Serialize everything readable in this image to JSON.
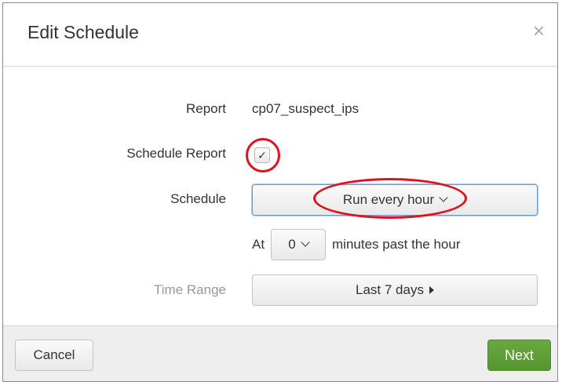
{
  "dialog": {
    "title": "Edit Schedule",
    "close_label": "×"
  },
  "form": {
    "report_label": "Report",
    "report_value": "cp07_suspect_ips",
    "schedule_report_label": "Schedule Report",
    "schedule_report_checked": true,
    "schedule_report_check_glyph": "✓",
    "schedule_label": "Schedule",
    "schedule_value": "Run every hour",
    "at_label": "At",
    "minute_value": "0",
    "minutes_suffix": "minutes past the hour",
    "time_range_label": "Time Range",
    "time_range_value": "Last 7 days"
  },
  "footer": {
    "cancel_label": "Cancel",
    "next_label": "Next"
  },
  "annotations": {
    "highlight_color": "#e0111c"
  },
  "colors": {
    "primary_button": "#5fa035",
    "focus_border": "#6e9bd3"
  }
}
